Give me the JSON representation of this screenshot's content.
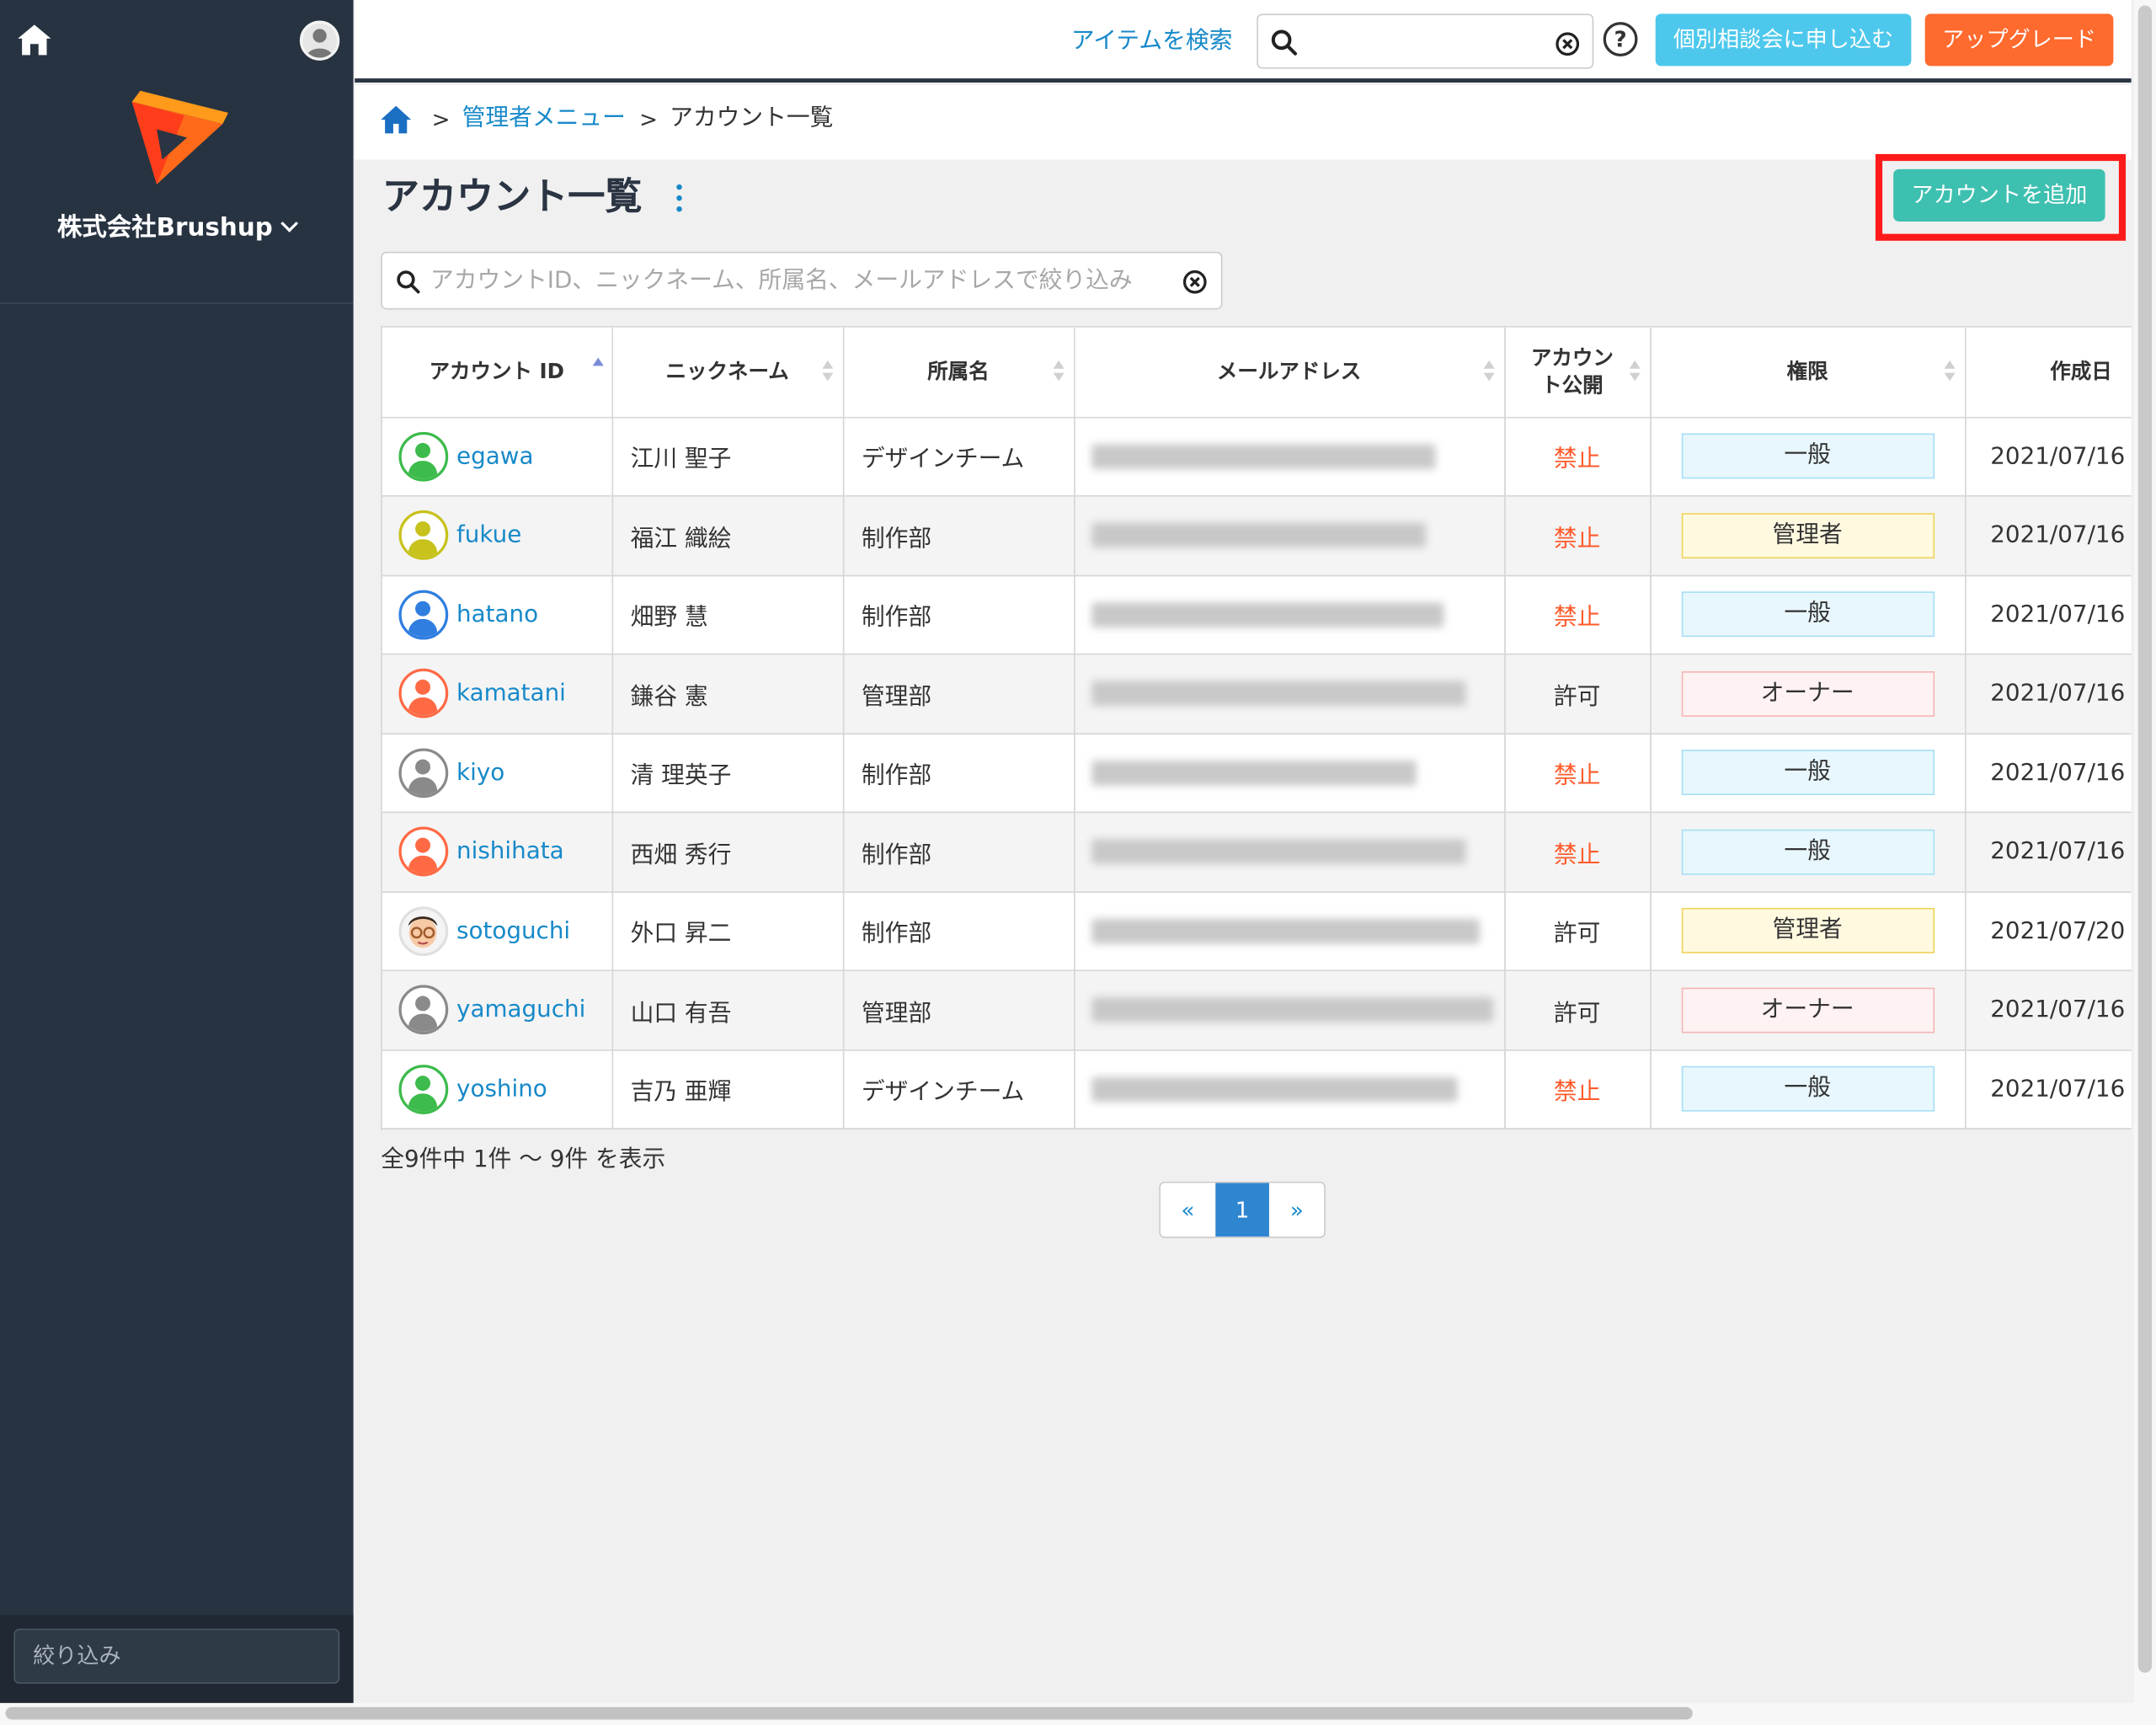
{
  "sidebar": {
    "company": "株式会社Brushup",
    "filter_placeholder": "絞り込み"
  },
  "topbar": {
    "search_link": "アイテムを検索",
    "search_value": "",
    "help": "?",
    "consult_button": "個別相談会に申し込む",
    "upgrade_button": "アップグレード"
  },
  "breadcrumb": {
    "sep": ">",
    "admin_menu": "管理者メニュー",
    "current": "アカウント一覧"
  },
  "page": {
    "title": "アカウント一覧",
    "add_button": "アカウントを追加",
    "filter_placeholder": "アカウントID、ニックネーム、所属名、メールアドレスで絞り込み"
  },
  "table": {
    "headers": [
      "アカウント ID",
      "ニックネーム",
      "所属名",
      "メールアドレス",
      "アカウント公開",
      "権限",
      "作成日"
    ],
    "rows": [
      {
        "id": "egawa",
        "nickname": "江川 聖子",
        "dept": "デザインチーム",
        "public": "禁止",
        "role": "一般",
        "created": "2021/07/16",
        "avatar": "user-icon-green"
      },
      {
        "id": "fukue",
        "nickname": "福江 織絵",
        "dept": "制作部",
        "public": "禁止",
        "role": "管理者",
        "created": "2021/07/16",
        "avatar": "user-icon-yellow"
      },
      {
        "id": "hatano",
        "nickname": "畑野 慧",
        "dept": "制作部",
        "public": "禁止",
        "role": "一般",
        "created": "2021/07/16",
        "avatar": "user-icon-blue"
      },
      {
        "id": "kamatani",
        "nickname": "鎌谷 憲",
        "dept": "管理部",
        "public": "許可",
        "role": "オーナー",
        "created": "2021/07/16",
        "avatar": "user-icon-orange"
      },
      {
        "id": "kiyo",
        "nickname": "清 理英子",
        "dept": "制作部",
        "public": "禁止",
        "role": "一般",
        "created": "2021/07/16",
        "avatar": "user-icon-gray"
      },
      {
        "id": "nishihata",
        "nickname": "西畑 秀行",
        "dept": "制作部",
        "public": "禁止",
        "role": "一般",
        "created": "2021/07/16",
        "avatar": "user-icon-orange"
      },
      {
        "id": "sotoguchi",
        "nickname": "外口 昇二",
        "dept": "制作部",
        "public": "許可",
        "role": "管理者",
        "created": "2021/07/20",
        "avatar": "face-photo-avatar"
      },
      {
        "id": "yamaguchi",
        "nickname": "山口 有吾",
        "dept": "管理部",
        "public": "許可",
        "role": "オーナー",
        "created": "2021/07/16",
        "avatar": "user-icon-gray"
      },
      {
        "id": "yoshino",
        "nickname": "吉乃 亜輝",
        "dept": "デザインチーム",
        "public": "禁止",
        "role": "一般",
        "created": "2021/07/16",
        "avatar": "user-icon-green"
      }
    ]
  },
  "pagination": {
    "summary": "全9件中 1件 〜 9件 を表示",
    "prev": "«",
    "current": "1",
    "next": "»"
  },
  "colors": {
    "sidebar": "#283341",
    "accent_link": "#1789c9",
    "add_button": "#3ec0b0",
    "consult_button": "#4dc8ec",
    "upgrade_button": "#ff6a2e",
    "highlight_frame": "#ff1a1a",
    "banned_text": "#ff5a2a"
  }
}
